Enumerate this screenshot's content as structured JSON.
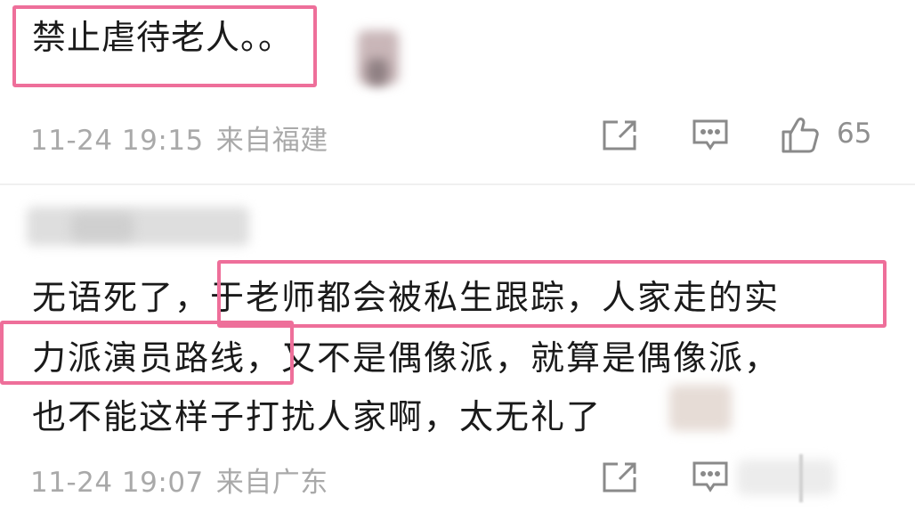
{
  "comments": [
    {
      "text": "禁止虐待老人。。",
      "date": "11-24 19:15",
      "location": "来自福建",
      "likes": "65"
    },
    {
      "lines": [
        "无语死了，于老师都会被私生跟踪，人家走的实",
        "力派演员路线，又不是偶像派，就算是偶像派，",
        "也不能这样子打扰人家啊，太无礼了"
      ],
      "date": "11-24 19:07",
      "location": "来自广东"
    }
  ],
  "icons": {
    "share": "share-icon",
    "reply": "comment-icon",
    "like": "thumbs-up-icon"
  },
  "colors": {
    "highlight": "#ee6f9a",
    "meta_text": "#a9a9a9",
    "body_text": "#1a1a1a"
  }
}
